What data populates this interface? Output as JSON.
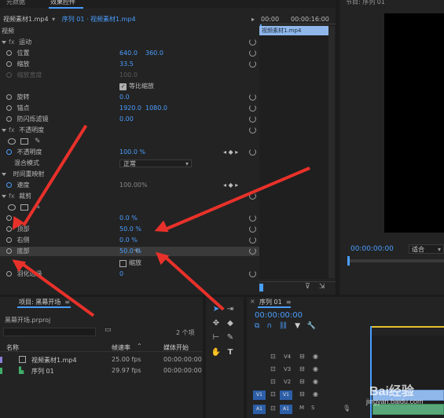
{
  "effect_controls": {
    "top_tab_left": "元数据",
    "tab_title": "效果控件",
    "source_clip": "视频素材1.mp4",
    "sequence_clip": "序列 01 · 视频素材1.mp4",
    "time_start": "00:00",
    "time_end": "00:00:16:00",
    "clip_bar_label": "视频素材1.mp4",
    "section_video": "视频",
    "motion": "运动",
    "position_label": "位置",
    "position_x": "640.0",
    "position_y": "360.0",
    "scale_label": "缩放",
    "scale_value": "33.5",
    "scale_width_label": "缩放宽度",
    "scale_width_value": "100.0",
    "uniform_scale_label": "等比缩放",
    "rotation_label": "旋转",
    "rotation_value": "0.0",
    "anchor_label": "锚点",
    "anchor_x": "1920.0",
    "anchor_y": "1080.0",
    "anti_flicker_label": "防闪烁滤镜",
    "anti_flicker_value": "0.00",
    "opacity_section": "不透明度",
    "opacity_label": "不透明度",
    "opacity_value": "100.0 %",
    "blend_label": "混合模式",
    "blend_value": "正常",
    "time_remap": "时间重映射",
    "speed_label": "速度",
    "speed_value": "100.00%",
    "crop_section": "裁剪",
    "crop_left_value": "0.0 %",
    "crop_top_label": "顶部",
    "crop_top_value": "50.0 %",
    "crop_right_label": "右侧",
    "crop_right_value": "0.0 %",
    "crop_bottom_label": "底部",
    "crop_bottom_value": "50.0 %",
    "zoom_label": "缩放",
    "feather_label": "羽化边缘",
    "feather_value": "0"
  },
  "program": {
    "title": "节目: 序列 01",
    "timecode": "00:00:00:00",
    "fit_label": "适合"
  },
  "project": {
    "title": "项目: 黑幕开场",
    "file_name": "黑幕开场.prproj",
    "item_count": "2 个项",
    "col_name": "名称",
    "col_fps": "帧速率",
    "col_start": "媒体开始",
    "items": [
      {
        "name": "视频素材1.mp4",
        "fps": "25.00 fps",
        "start": "00:00:00:00"
      },
      {
        "name": "序列 01",
        "fps": "29.97 fps",
        "start": "00:00:00:00"
      }
    ]
  },
  "timeline": {
    "title": "序列 01",
    "timecode": "00:00:00:00",
    "tracks": [
      "V4",
      "V3",
      "V2",
      "V1",
      "A1"
    ],
    "source_patch_v": "V1",
    "source_patch_a": "A1"
  },
  "watermark": {
    "brand": "Bai经验",
    "url": "jingyan.baidu.com"
  },
  "colors": {
    "accent": "#4a9eff",
    "arrow": "#e8312a",
    "clip_blue": "#8fb7ea"
  }
}
